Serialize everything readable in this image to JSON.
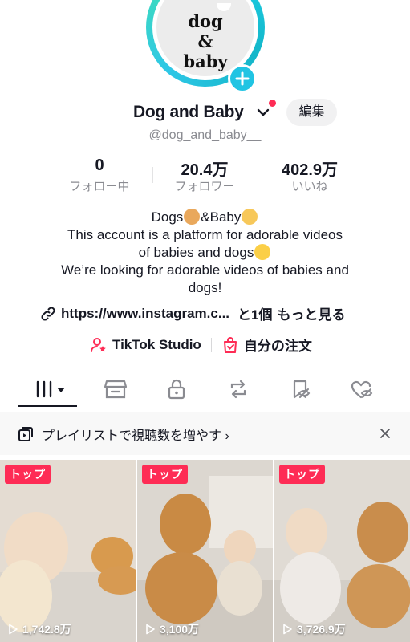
{
  "profile": {
    "avatar_text": "dog\n&\nbaby",
    "display_name": "Dog and Baby",
    "handle": "@dog_and_baby__",
    "edit_label": "編集"
  },
  "stats": [
    {
      "value": "0",
      "label": "フォロー中"
    },
    {
      "value": "20.4万",
      "label": "フォロワー"
    },
    {
      "value": "402.9万",
      "label": "いいね"
    }
  ],
  "bio": {
    "line1_a": "Dogs",
    "line1_b": "&Baby",
    "line2": "This account is a platform for adorable videos",
    "line3": "of babies and dogs",
    "line4": "We’re looking for adorable videos of babies and",
    "line5": "dogs!"
  },
  "link": {
    "url": "https://www.instagram.c...",
    "extra": "と1個",
    "more": "もっと見る"
  },
  "tools": {
    "studio": "TikTok Studio",
    "orders": "自分の注文"
  },
  "playlist_banner": "プレイリストで視聴数を増やす ›",
  "videos": [
    {
      "badge": "トップ",
      "views": "1,742.8万"
    },
    {
      "badge": "トップ",
      "views": "3,100万"
    },
    {
      "badge": "トップ",
      "views": "3,726.9万"
    }
  ],
  "colors": {
    "accent": "#fe2c55",
    "ring": "#20d5ec",
    "text": "#161823",
    "muted": "#8a8b91"
  }
}
